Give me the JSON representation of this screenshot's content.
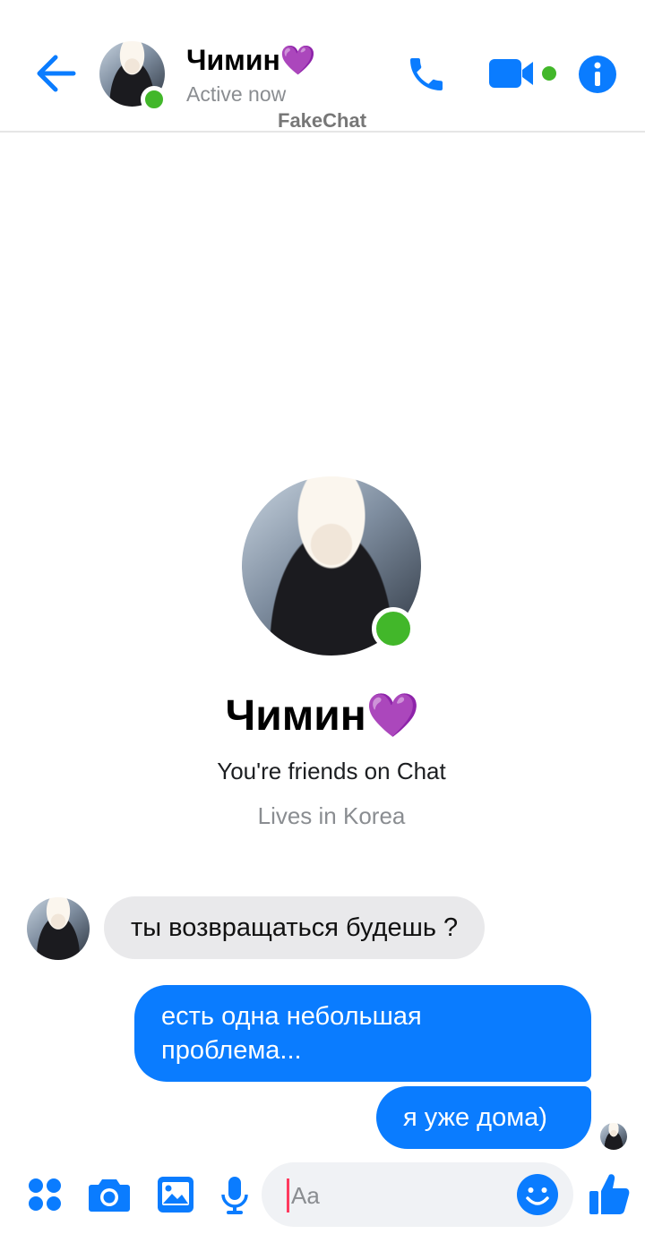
{
  "header": {
    "back_icon": "arrow-left-icon",
    "contact_name": "Чимин💜",
    "status": "Active now",
    "watermark": "FakeChat",
    "call_icon": "phone-icon",
    "video_icon": "video-camera-icon",
    "info_icon": "info-icon"
  },
  "profile": {
    "name": "Чимин💜",
    "friends_text": "You're friends on Chat",
    "location_text": "Lives in Korea"
  },
  "messages": [
    {
      "direction": "incoming",
      "text": "ты возвращаться будешь ?"
    },
    {
      "direction": "outgoing",
      "text": "есть одна небольшая проблема..."
    },
    {
      "direction": "outgoing",
      "text": "я уже дома)"
    }
  ],
  "composer": {
    "placeholder": "Aa",
    "menu_icon": "apps-grid-icon",
    "camera_icon": "camera-icon",
    "gallery_icon": "image-icon",
    "mic_icon": "microphone-icon",
    "emoji_icon": "smiley-icon",
    "like_icon": "thumbs-up-icon"
  },
  "colors": {
    "accent": "#0a7cff",
    "online": "#42b72a",
    "incoming_bubble": "#e9e9eb",
    "secondary_text": "#8a8d91"
  }
}
